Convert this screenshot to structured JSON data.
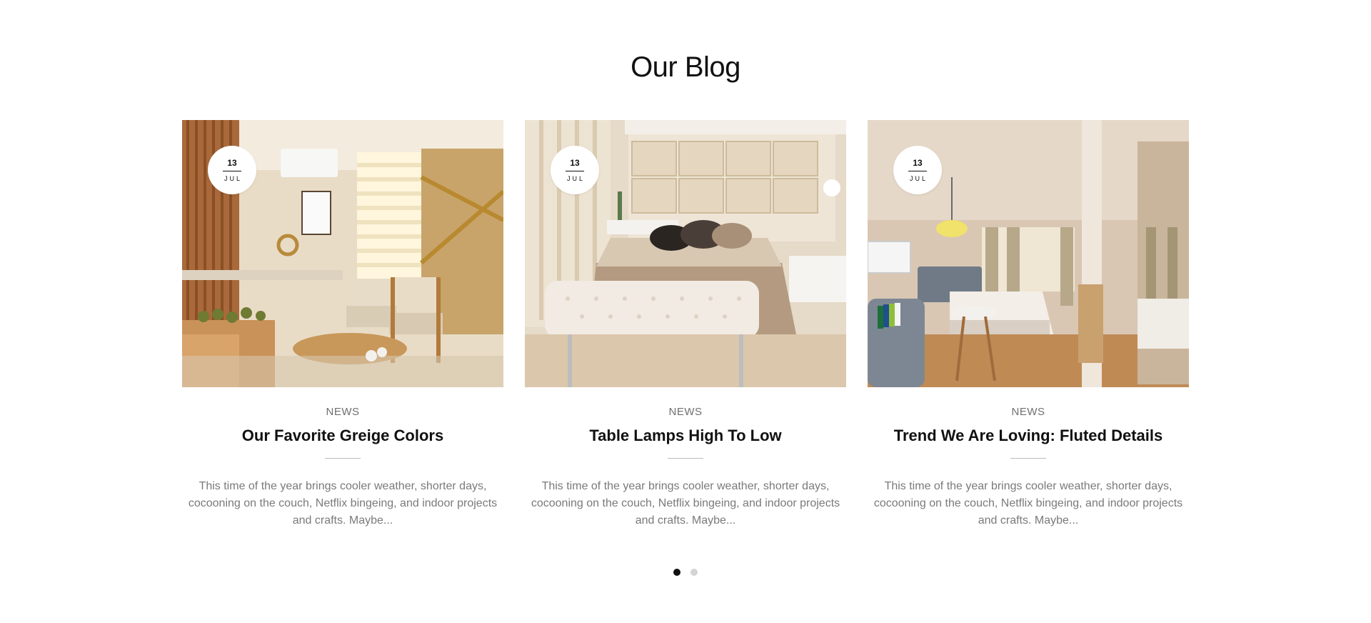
{
  "section": {
    "title": "Our Blog"
  },
  "posts": [
    {
      "day": "13",
      "month": "JUL",
      "category": "NEWS",
      "title": "Our Favorite Greige Colors",
      "excerpt": "This time of the year brings cooler weather, shorter days, cocooning on the couch, Netflix bingeing, and indoor projects and crafts. Maybe...",
      "image": "living-room-photo"
    },
    {
      "day": "13",
      "month": "JUL",
      "category": "NEWS",
      "title": "Table Lamps High To Low",
      "excerpt": "This time of the year brings cooler weather, shorter days, cocooning on the couch, Netflix bingeing, and indoor projects and crafts. Maybe...",
      "image": "bedroom-photo"
    },
    {
      "day": "13",
      "month": "JUL",
      "category": "NEWS",
      "title": "Trend We Are Loving: Fluted Details",
      "excerpt": "This time of the year brings cooler weather, shorter days, cocooning on the couch, Netflix bingeing, and indoor projects and crafts. Maybe...",
      "image": "hotel-room-photo"
    }
  ],
  "pagination": {
    "total_pages": 2,
    "active_page": 1
  }
}
